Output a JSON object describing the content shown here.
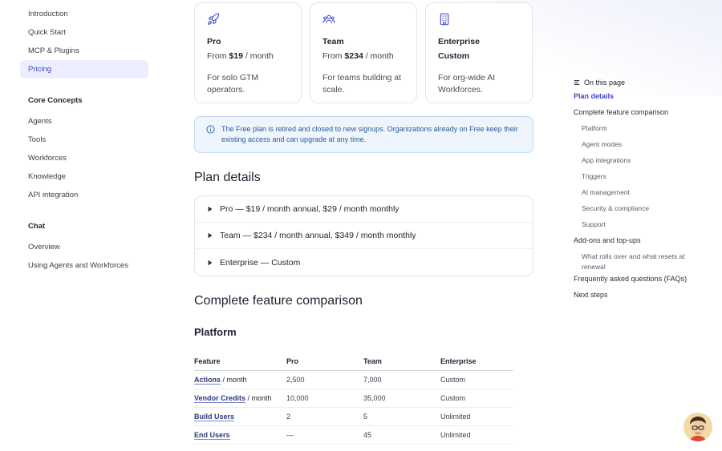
{
  "sidebar": {
    "group1": [
      {
        "label": "Introduction"
      },
      {
        "label": "Quick Start"
      },
      {
        "label": "MCP & Plugins"
      },
      {
        "label": "Pricing",
        "active": true
      }
    ],
    "group2_heading": "Core Concepts",
    "group2": [
      {
        "label": "Agents"
      },
      {
        "label": "Tools"
      },
      {
        "label": "Workforces"
      },
      {
        "label": "Knowledge"
      },
      {
        "label": "API integration"
      }
    ],
    "group3_heading": "Chat",
    "group3": [
      {
        "label": "Overview"
      },
      {
        "label": "Using Agents and Workforces"
      }
    ]
  },
  "plans": [
    {
      "icon": "rocket-icon",
      "name": "Pro",
      "prefix": "From",
      "price": "$19",
      "period": "/ month",
      "desc": "For solo GTM operators."
    },
    {
      "icon": "users-icon",
      "name": "Team",
      "prefix": "From",
      "price": "$234",
      "period": "/ month",
      "desc": "For teams building at scale."
    },
    {
      "icon": "building-icon",
      "name": "Enterprise",
      "price_label": "Custom",
      "desc": "For org-wide AI Workforces."
    }
  ],
  "notice": {
    "text": "The Free plan is retired and closed to new signups. Organizations already on Free keep their existing access and can upgrade at any time."
  },
  "plan_details": {
    "heading": "Plan details",
    "rows": [
      {
        "label": "Pro — $19 / month annual, $29 / month monthly"
      },
      {
        "label": "Team — $234 / month annual, $349 / month monthly"
      },
      {
        "label": "Enterprise — Custom"
      }
    ]
  },
  "comparison": {
    "heading": "Complete feature comparison",
    "subheading": "Platform",
    "columns": [
      "Feature",
      "Pro",
      "Team",
      "Enterprise"
    ],
    "rows": [
      {
        "feature": "Actions",
        "suffix": " / month",
        "pro": "2,500",
        "team": "7,000",
        "enterprise": "Custom"
      },
      {
        "feature": "Vendor Credits",
        "suffix": " / month",
        "pro": "10,000",
        "team": "35,000",
        "enterprise": "Custom"
      },
      {
        "feature": "Build Users",
        "suffix": "",
        "pro": "2",
        "team": "5",
        "enterprise": "Unlimited"
      },
      {
        "feature": "End Users",
        "suffix": "",
        "pro": "—",
        "team": "45",
        "enterprise": "Unlimited"
      }
    ]
  },
  "toc": {
    "heading": "On this page",
    "items": [
      {
        "label": "Plan details",
        "level": 1,
        "active": true
      },
      {
        "label": "Complete feature comparison",
        "level": 1
      },
      {
        "label": "Platform",
        "level": 2
      },
      {
        "label": "Agent modes",
        "level": 2
      },
      {
        "label": "App integrations",
        "level": 2
      },
      {
        "label": "Triggers",
        "level": 2
      },
      {
        "label": "AI management",
        "level": 2
      },
      {
        "label": "Security & compliance",
        "level": 2
      },
      {
        "label": "Support",
        "level": 2
      },
      {
        "label": "Add-ons and top-ups",
        "level": 1
      },
      {
        "label": "What rolls over and what resets at renewal",
        "level": 2
      },
      {
        "label": "Frequently asked questions (FAQs)",
        "level": 1
      },
      {
        "label": "Next steps",
        "level": 1
      }
    ]
  },
  "colors": {
    "accent": "#3f49c4",
    "active_bg": "#eceefd",
    "notice_bg": "#eef5fd",
    "notice_border": "#c4d9f2"
  }
}
